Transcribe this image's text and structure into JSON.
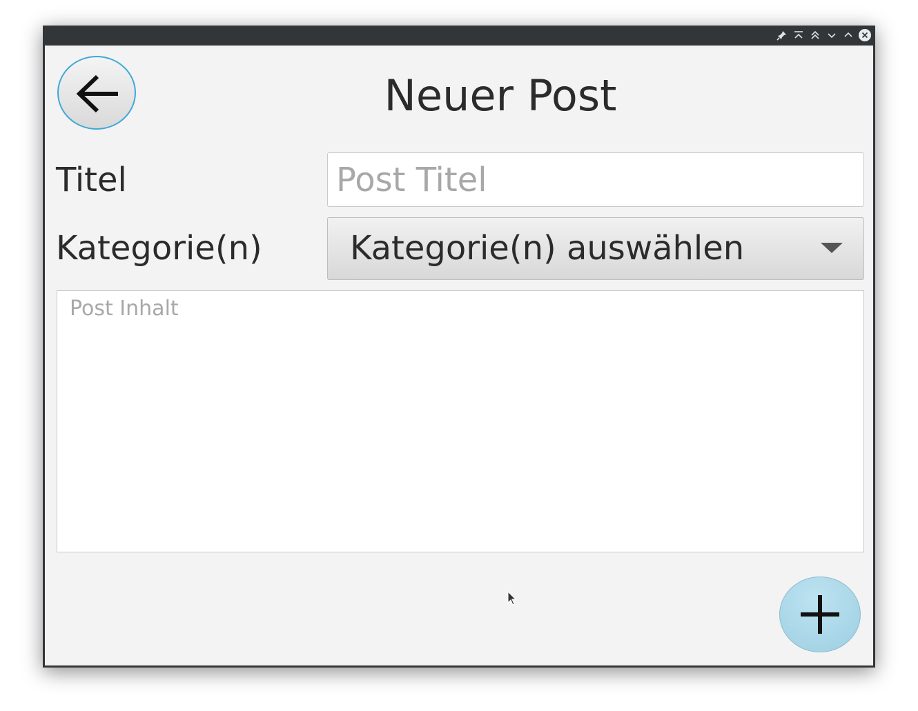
{
  "window": {
    "titlebar_buttons": [
      "pin-icon",
      "keep-above-icon",
      "shade-up-icon",
      "minimize-icon",
      "maximize-icon",
      "close-icon"
    ]
  },
  "header": {
    "back_icon": "arrow-left-icon",
    "title": "Neuer Post"
  },
  "form": {
    "title_label": "Titel",
    "title_placeholder": "Post Titel",
    "title_value": "",
    "category_label": "Kategorie(n)",
    "category_selected": "Kategorie(n) auswählen",
    "content_placeholder": "Post Inhalt",
    "content_value": ""
  },
  "actions": {
    "add_icon": "plus-icon"
  },
  "colors": {
    "titlebar": "#323639",
    "background": "#f3f3f3",
    "accent_border": "#3fa8d8",
    "add_button": "#a9d6e7"
  }
}
